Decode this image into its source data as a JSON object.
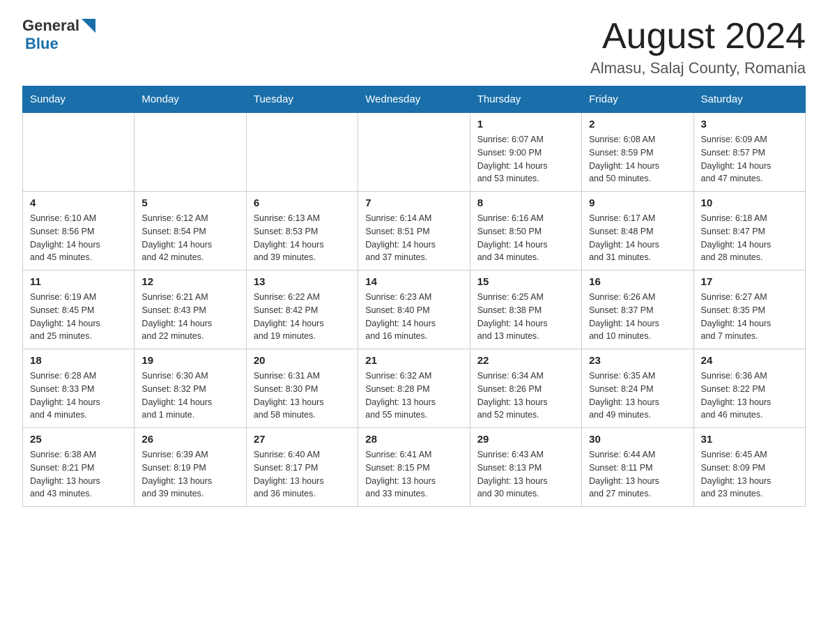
{
  "header": {
    "logo_general": "General",
    "logo_blue": "Blue",
    "month_title": "August 2024",
    "location": "Almasu, Salaj County, Romania"
  },
  "weekdays": [
    "Sunday",
    "Monday",
    "Tuesday",
    "Wednesday",
    "Thursday",
    "Friday",
    "Saturday"
  ],
  "weeks": [
    [
      {
        "day": "",
        "info": ""
      },
      {
        "day": "",
        "info": ""
      },
      {
        "day": "",
        "info": ""
      },
      {
        "day": "",
        "info": ""
      },
      {
        "day": "1",
        "info": "Sunrise: 6:07 AM\nSunset: 9:00 PM\nDaylight: 14 hours\nand 53 minutes."
      },
      {
        "day": "2",
        "info": "Sunrise: 6:08 AM\nSunset: 8:59 PM\nDaylight: 14 hours\nand 50 minutes."
      },
      {
        "day": "3",
        "info": "Sunrise: 6:09 AM\nSunset: 8:57 PM\nDaylight: 14 hours\nand 47 minutes."
      }
    ],
    [
      {
        "day": "4",
        "info": "Sunrise: 6:10 AM\nSunset: 8:56 PM\nDaylight: 14 hours\nand 45 minutes."
      },
      {
        "day": "5",
        "info": "Sunrise: 6:12 AM\nSunset: 8:54 PM\nDaylight: 14 hours\nand 42 minutes."
      },
      {
        "day": "6",
        "info": "Sunrise: 6:13 AM\nSunset: 8:53 PM\nDaylight: 14 hours\nand 39 minutes."
      },
      {
        "day": "7",
        "info": "Sunrise: 6:14 AM\nSunset: 8:51 PM\nDaylight: 14 hours\nand 37 minutes."
      },
      {
        "day": "8",
        "info": "Sunrise: 6:16 AM\nSunset: 8:50 PM\nDaylight: 14 hours\nand 34 minutes."
      },
      {
        "day": "9",
        "info": "Sunrise: 6:17 AM\nSunset: 8:48 PM\nDaylight: 14 hours\nand 31 minutes."
      },
      {
        "day": "10",
        "info": "Sunrise: 6:18 AM\nSunset: 8:47 PM\nDaylight: 14 hours\nand 28 minutes."
      }
    ],
    [
      {
        "day": "11",
        "info": "Sunrise: 6:19 AM\nSunset: 8:45 PM\nDaylight: 14 hours\nand 25 minutes."
      },
      {
        "day": "12",
        "info": "Sunrise: 6:21 AM\nSunset: 8:43 PM\nDaylight: 14 hours\nand 22 minutes."
      },
      {
        "day": "13",
        "info": "Sunrise: 6:22 AM\nSunset: 8:42 PM\nDaylight: 14 hours\nand 19 minutes."
      },
      {
        "day": "14",
        "info": "Sunrise: 6:23 AM\nSunset: 8:40 PM\nDaylight: 14 hours\nand 16 minutes."
      },
      {
        "day": "15",
        "info": "Sunrise: 6:25 AM\nSunset: 8:38 PM\nDaylight: 14 hours\nand 13 minutes."
      },
      {
        "day": "16",
        "info": "Sunrise: 6:26 AM\nSunset: 8:37 PM\nDaylight: 14 hours\nand 10 minutes."
      },
      {
        "day": "17",
        "info": "Sunrise: 6:27 AM\nSunset: 8:35 PM\nDaylight: 14 hours\nand 7 minutes."
      }
    ],
    [
      {
        "day": "18",
        "info": "Sunrise: 6:28 AM\nSunset: 8:33 PM\nDaylight: 14 hours\nand 4 minutes."
      },
      {
        "day": "19",
        "info": "Sunrise: 6:30 AM\nSunset: 8:32 PM\nDaylight: 14 hours\nand 1 minute."
      },
      {
        "day": "20",
        "info": "Sunrise: 6:31 AM\nSunset: 8:30 PM\nDaylight: 13 hours\nand 58 minutes."
      },
      {
        "day": "21",
        "info": "Sunrise: 6:32 AM\nSunset: 8:28 PM\nDaylight: 13 hours\nand 55 minutes."
      },
      {
        "day": "22",
        "info": "Sunrise: 6:34 AM\nSunset: 8:26 PM\nDaylight: 13 hours\nand 52 minutes."
      },
      {
        "day": "23",
        "info": "Sunrise: 6:35 AM\nSunset: 8:24 PM\nDaylight: 13 hours\nand 49 minutes."
      },
      {
        "day": "24",
        "info": "Sunrise: 6:36 AM\nSunset: 8:22 PM\nDaylight: 13 hours\nand 46 minutes."
      }
    ],
    [
      {
        "day": "25",
        "info": "Sunrise: 6:38 AM\nSunset: 8:21 PM\nDaylight: 13 hours\nand 43 minutes."
      },
      {
        "day": "26",
        "info": "Sunrise: 6:39 AM\nSunset: 8:19 PM\nDaylight: 13 hours\nand 39 minutes."
      },
      {
        "day": "27",
        "info": "Sunrise: 6:40 AM\nSunset: 8:17 PM\nDaylight: 13 hours\nand 36 minutes."
      },
      {
        "day": "28",
        "info": "Sunrise: 6:41 AM\nSunset: 8:15 PM\nDaylight: 13 hours\nand 33 minutes."
      },
      {
        "day": "29",
        "info": "Sunrise: 6:43 AM\nSunset: 8:13 PM\nDaylight: 13 hours\nand 30 minutes."
      },
      {
        "day": "30",
        "info": "Sunrise: 6:44 AM\nSunset: 8:11 PM\nDaylight: 13 hours\nand 27 minutes."
      },
      {
        "day": "31",
        "info": "Sunrise: 6:45 AM\nSunset: 8:09 PM\nDaylight: 13 hours\nand 23 minutes."
      }
    ]
  ]
}
